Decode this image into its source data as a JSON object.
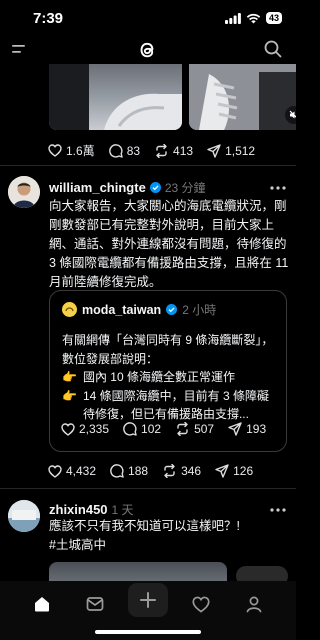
{
  "status": {
    "time": "7:39",
    "battery": "43"
  },
  "feed": {
    "prev_post": {
      "likes": "1.6萬",
      "replies": "83",
      "reposts": "413",
      "shares": "1,512"
    },
    "post": {
      "author": "william_chingte",
      "time": "23 分鐘",
      "text": "向大家報告，大家關心的海底電纜狀況，剛剛數發部已有完整對外說明，目前大家上網、通話、對外連線都沒有問題，待修復的 3 條國際電纜都有備援路由支撐，且將在 11月前陸續修復完成。",
      "quote": {
        "author": "moda_taiwan",
        "time": "2 小時",
        "text_line1": "有關網傳「台灣同時有 9 條海纜斷裂」，數位發展部說明：",
        "bullet1": "國內 10 條海纜全數正常運作",
        "bullet2": "14 條國際海纜中，目前有 3 條障礙待修復，但已有備援路由支撐...",
        "likes": "2,335",
        "replies": "102",
        "reposts": "507",
        "shares": "193"
      },
      "likes": "4,432",
      "replies": "188",
      "reposts": "346",
      "shares": "126"
    },
    "reply_post": {
      "author": "zhixin450",
      "time": "1 天",
      "text": "應該不只有我不知道可以這樣吧？!",
      "hashtag": "#土城高中"
    }
  },
  "colors": {
    "verified": "#0095f6",
    "background": "#000000",
    "divider": "#262626"
  }
}
